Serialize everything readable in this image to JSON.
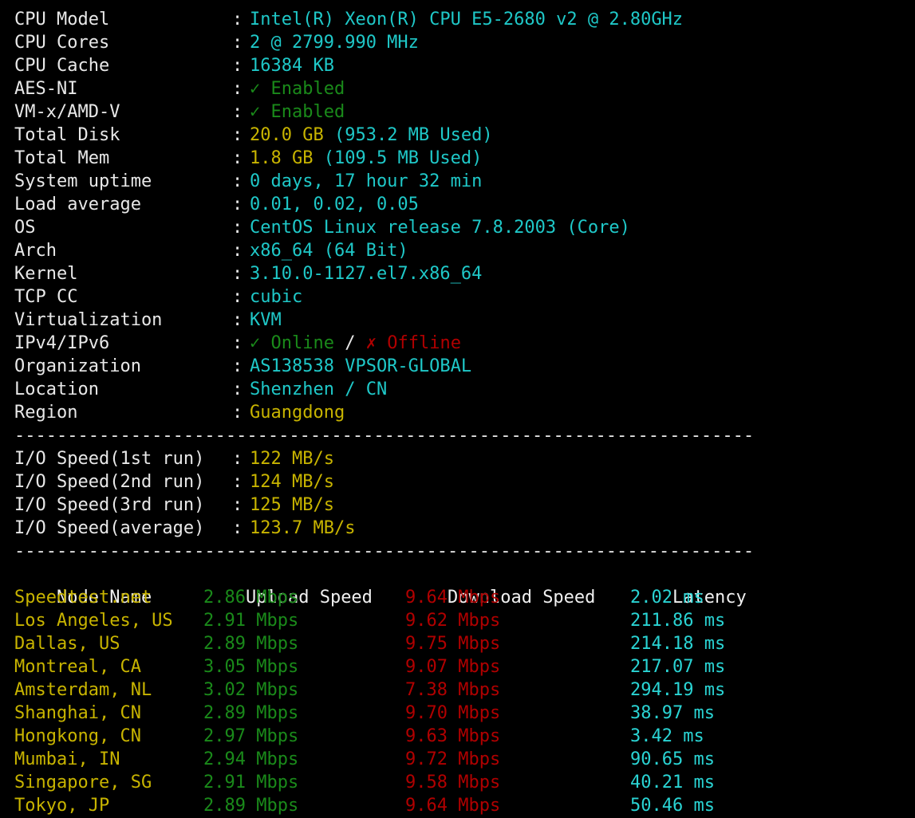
{
  "system_info": {
    "rows": [
      {
        "label": "CPU Model",
        "value": "Intel(R) Xeon(R) CPU E5-2680 v2 @ 2.80GHz",
        "style": "value"
      },
      {
        "label": "CPU Cores",
        "value": "2 @ 2799.990 MHz",
        "style": "value"
      },
      {
        "label": "CPU Cache",
        "value": "16384 KB",
        "style": "value"
      },
      {
        "label": "AES-NI",
        "value": "Enabled",
        "style": "ok",
        "glyph": "check"
      },
      {
        "label": "VM-x/AMD-V",
        "value": "Enabled",
        "style": "ok",
        "glyph": "check"
      },
      {
        "label": "Total Disk",
        "value": "20.0 GB",
        "style": "accent",
        "suffix": " (953.2 MB Used)"
      },
      {
        "label": "Total Mem",
        "value": "1.8 GB",
        "style": "accent",
        "suffix": " (109.5 MB Used)"
      },
      {
        "label": "System uptime",
        "value": "0 days, 17 hour 32 min",
        "style": "value"
      },
      {
        "label": "Load average",
        "value": "0.01, 0.02, 0.05",
        "style": "value"
      },
      {
        "label": "OS",
        "value": "CentOS Linux release 7.8.2003 (Core)",
        "style": "value"
      },
      {
        "label": "Arch",
        "value": "x86_64 (64 Bit)",
        "style": "value"
      },
      {
        "label": "Kernel",
        "value": "3.10.0-1127.el7.x86_64",
        "style": "value"
      },
      {
        "label": "TCP CC",
        "value": "cubic",
        "style": "value"
      },
      {
        "label": "Virtualization",
        "value": "KVM",
        "style": "value"
      },
      {
        "label": "IPv4/IPv6",
        "value": "",
        "style": "dual",
        "ipv4": "Online",
        "ipv6": "Offline"
      },
      {
        "label": "Organization",
        "value": "AS138538 VPSOR-GLOBAL",
        "style": "value"
      },
      {
        "label": "Location",
        "value": "Shenzhen / CN",
        "style": "value"
      },
      {
        "label": "Region",
        "value": "Guangdong",
        "style": "accent"
      }
    ]
  },
  "separator": {
    "text": "----------------------------------------------------------------------"
  },
  "io_speed": {
    "rows": [
      {
        "label": "I/O Speed(1st run)",
        "value": "122 MB/s"
      },
      {
        "label": "I/O Speed(2nd run)",
        "value": "124 MB/s"
      },
      {
        "label": "I/O Speed(3rd run)",
        "value": "125 MB/s"
      },
      {
        "label": "I/O Speed(average)",
        "value": "123.7 MB/s"
      }
    ]
  },
  "speedtest": {
    "headers": {
      "node": "Node Name",
      "upload": "Upload Speed",
      "download": "Download Speed",
      "latency": "Latency"
    },
    "rows": [
      {
        "node": "Speedtest.net",
        "upload": "2.86 Mbps",
        "download": "9.64 Mbps",
        "latency": "2.02 ms"
      },
      {
        "node": "Los Angeles, US",
        "upload": "2.91 Mbps",
        "download": "9.62 Mbps",
        "latency": "211.86 ms"
      },
      {
        "node": "Dallas, US",
        "upload": "2.89 Mbps",
        "download": "9.75 Mbps",
        "latency": "214.18 ms"
      },
      {
        "node": "Montreal, CA",
        "upload": "3.05 Mbps",
        "download": "9.07 Mbps",
        "latency": "217.07 ms"
      },
      {
        "node": "Amsterdam, NL",
        "upload": "3.02 Mbps",
        "download": "7.38 Mbps",
        "latency": "294.19 ms"
      },
      {
        "node": "Shanghai, CN",
        "upload": "2.89 Mbps",
        "download": "9.70 Mbps",
        "latency": "38.97 ms"
      },
      {
        "node": "Hongkong, CN",
        "upload": "2.97 Mbps",
        "download": "9.63 Mbps",
        "latency": "3.42 ms"
      },
      {
        "node": "Mumbai, IN",
        "upload": "2.94 Mbps",
        "download": "9.72 Mbps",
        "latency": "90.65 ms"
      },
      {
        "node": "Singapore, SG",
        "upload": "2.91 Mbps",
        "download": "9.58 Mbps",
        "latency": "40.21 ms"
      },
      {
        "node": "Tokyo, JP",
        "upload": "2.89 Mbps",
        "download": "9.64 Mbps",
        "latency": "50.46 ms"
      }
    ]
  },
  "glyphs": {
    "check": "✓",
    "cross": "✗",
    "colon": ":",
    "slash": "/"
  },
  "colors": {
    "background": "#000000",
    "label": "#e8e8e8",
    "value_teal": "#1fc8c8",
    "accent_yellow": "#c8b400",
    "ok_green": "#1a8a1a",
    "bad_red": "#b00000",
    "latency_cyan": "#2ad4d4"
  }
}
